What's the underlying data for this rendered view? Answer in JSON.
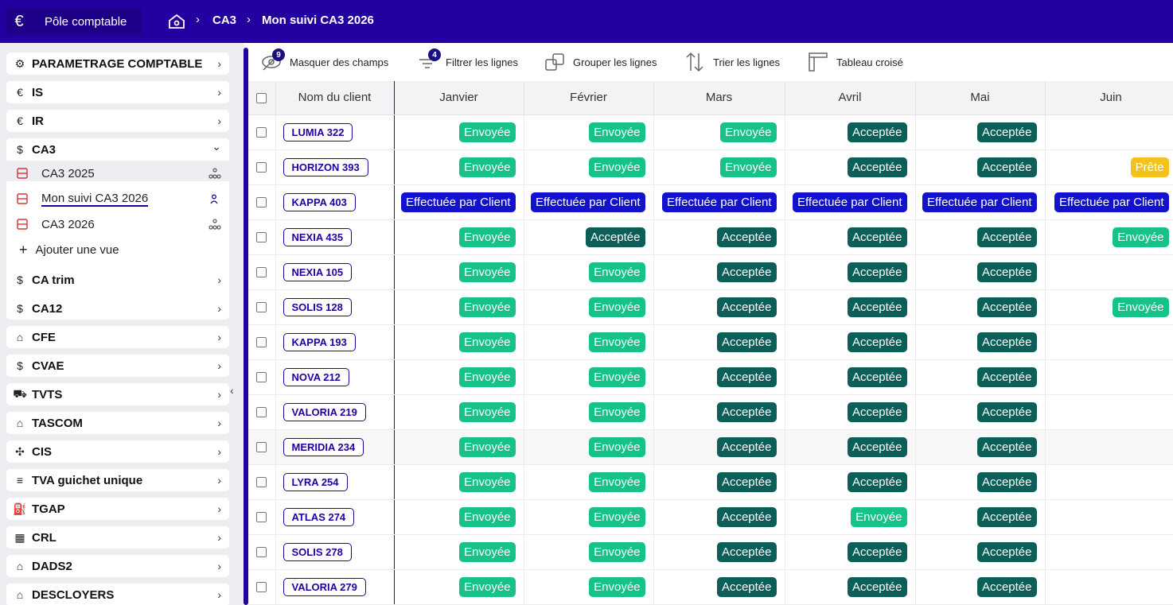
{
  "header": {
    "app_label": "Pôle comptable",
    "breadcrumb": [
      "CA3",
      "Mon suivi CA3 2026"
    ]
  },
  "sidebar": {
    "items_top": [
      {
        "icon": "gear-icon",
        "glyph": "⚙",
        "label": "PARAMETRAGE COMPTABLE"
      },
      {
        "icon": "euro-icon",
        "glyph": "€",
        "label": "IS"
      },
      {
        "icon": "euro-icon",
        "glyph": "€",
        "label": "IR"
      },
      {
        "icon": "dollar-icon",
        "glyph": "$",
        "label": "CA3"
      }
    ],
    "subviews": [
      {
        "label": "CA3 2025",
        "right_icon": "share-icon"
      },
      {
        "label": "Mon suivi CA3 2026",
        "right_icon": "person-icon"
      },
      {
        "label": "CA3 2026",
        "right_icon": "share-icon"
      }
    ],
    "add_view_label": "Ajouter une vue",
    "items_bottom": [
      {
        "icon": "dollar-icon",
        "glyph": "$",
        "label": "CA trim"
      },
      {
        "icon": "dollar-icon",
        "glyph": "$",
        "label": "CA12"
      },
      {
        "icon": "building-icon",
        "glyph": "⌂",
        "label": "CFE"
      },
      {
        "icon": "dollar-icon",
        "glyph": "$",
        "label": "CVAE"
      },
      {
        "icon": "truck-icon",
        "glyph": "⛟",
        "label": "TVTS"
      },
      {
        "icon": "store-icon",
        "glyph": "⌂",
        "label": "TASCOM"
      },
      {
        "icon": "network-icon",
        "glyph": "✣",
        "label": "CIS"
      },
      {
        "icon": "database-icon",
        "glyph": "≡",
        "label": "TVA guichet unique"
      },
      {
        "icon": "fuel-icon",
        "glyph": "⛽",
        "label": "TGAP"
      },
      {
        "icon": "calculator-icon",
        "glyph": "▦",
        "label": "CRL"
      },
      {
        "icon": "store-icon",
        "glyph": "⌂",
        "label": "DADS2"
      },
      {
        "icon": "store-icon",
        "glyph": "⌂",
        "label": "DESCLOYERS"
      }
    ]
  },
  "toolbar": {
    "hide_fields": {
      "label": "Masquer des champs",
      "count": "9"
    },
    "filter": {
      "label": "Filtrer les lignes",
      "count": "4"
    },
    "group": {
      "label": "Grouper les lignes"
    },
    "sort": {
      "label": "Trier les lignes"
    },
    "pivot": {
      "label": "Tableau croisé"
    }
  },
  "table": {
    "columns": [
      "Nom du client",
      "Janvier",
      "Février",
      "Mars",
      "Avril",
      "Mai",
      "Juin"
    ],
    "rows": [
      {
        "client": "LUMIA 322",
        "cells": [
          "Envoyée",
          "Envoyée",
          "Envoyée",
          "Acceptée",
          "Acceptée",
          ""
        ]
      },
      {
        "client": "HORIZON 393",
        "cells": [
          "Envoyée",
          "Envoyée",
          "Envoyée",
          "Acceptée",
          "Acceptée",
          "Prête"
        ]
      },
      {
        "client": "KAPPA 403",
        "cells": [
          "Effectuée par Client",
          "Effectuée par Client",
          "Effectuée par Client",
          "Effectuée par Client",
          "Effectuée par Client",
          "Effectuée par Client"
        ]
      },
      {
        "client": "NEXIA 435",
        "cells": [
          "Envoyée",
          "Acceptée",
          "Acceptée",
          "Acceptée",
          "Acceptée",
          "Envoyée"
        ]
      },
      {
        "client": "NEXIA 105",
        "cells": [
          "Envoyée",
          "Envoyée",
          "Acceptée",
          "Acceptée",
          "Acceptée",
          ""
        ]
      },
      {
        "client": "SOLIS 128",
        "cells": [
          "Envoyée",
          "Envoyée",
          "Acceptée",
          "Acceptée",
          "Acceptée",
          "Envoyée"
        ]
      },
      {
        "client": "KAPPA 193",
        "cells": [
          "Envoyée",
          "Envoyée",
          "Acceptée",
          "Acceptée",
          "Acceptée",
          ""
        ]
      },
      {
        "client": "NOVA 212",
        "cells": [
          "Envoyée",
          "Envoyée",
          "Acceptée",
          "Acceptée",
          "Acceptée",
          ""
        ]
      },
      {
        "client": "VALORIA 219",
        "cells": [
          "Envoyée",
          "Envoyée",
          "Acceptée",
          "Acceptée",
          "Acceptée",
          ""
        ]
      },
      {
        "client": "MERIDIA 234",
        "cells": [
          "Envoyée",
          "Envoyée",
          "Acceptée",
          "Acceptée",
          "Acceptée",
          ""
        ]
      },
      {
        "client": "LYRA 254",
        "cells": [
          "Envoyée",
          "Envoyée",
          "Acceptée",
          "Acceptée",
          "Acceptée",
          ""
        ]
      },
      {
        "client": "ATLAS 274",
        "cells": [
          "Envoyée",
          "Envoyée",
          "Acceptée",
          "Envoyée",
          "Acceptée",
          ""
        ]
      },
      {
        "client": "SOLIS 278",
        "cells": [
          "Envoyée",
          "Envoyée",
          "Acceptée",
          "Acceptée",
          "Acceptée",
          ""
        ]
      },
      {
        "client": "VALORIA 279",
        "cells": [
          "Envoyée",
          "Envoyée",
          "Acceptée",
          "Acceptée",
          "Acceptée",
          ""
        ]
      }
    ],
    "status_colors": {
      "Envoyée": "#17c289",
      "Acceptée": "#0b5f58",
      "Effectuée par Client": "#1212cc",
      "Prête": "#f4c21b"
    }
  }
}
